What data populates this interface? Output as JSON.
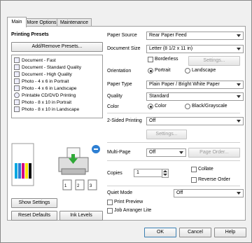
{
  "tabs": [
    "Main",
    "More Options",
    "Maintenance"
  ],
  "presets": {
    "title": "Printing Presets",
    "add_remove_label": "Add/Remove Presets...",
    "items": [
      "Document - Fast",
      "Document - Standard Quality",
      "Document - High Quality",
      "Photo - 4 x 6 in Portrait",
      "Photo - 4 x 6 in Landscape",
      "Printable CD/DVD Printing",
      "Photo - 8 x 10 in Portrait",
      "Photo - 8 x 10 in Landscape"
    ]
  },
  "settings": {
    "paper_source_label": "Paper Source",
    "paper_source_value": "Rear Paper Feed",
    "document_size_label": "Document Size",
    "document_size_value": "Letter (8 1/2 x 11 in)",
    "borderless_label": "Borderless",
    "borderless_settings_label": "Settings...",
    "orientation_label": "Orientation",
    "portrait_label": "Portrait",
    "landscape_label": "Landscape",
    "paper_type_label": "Paper Type",
    "paper_type_value": "Plain Paper / Bright White Paper",
    "quality_label": "Quality",
    "quality_value": "Standard",
    "color_label": "Color",
    "color_option_label": "Color",
    "bw_option_label": "Black/Grayscale",
    "two_sided_label": "2-Sided Printing",
    "two_sided_value": "Off",
    "two_sided_settings_label": "Settings...",
    "multipage_label": "Multi-Page",
    "multipage_value": "Off",
    "page_order_label": "Page Order...",
    "copies_label": "Copies",
    "copies_value": "1",
    "collate_label": "Collate",
    "reverse_order_label": "Reverse Order",
    "quiet_mode_label": "Quiet Mode",
    "quiet_mode_value": "Off",
    "print_preview_label": "Print Preview",
    "job_arranger_label": "Job Arranger Lite"
  },
  "left_buttons": {
    "show_settings": "Show Settings",
    "reset_defaults": "Reset Defaults",
    "ink_levels": "Ink Levels"
  },
  "footer": {
    "ok": "OK",
    "cancel": "Cancel",
    "help": "Help"
  },
  "colors": {
    "accent": "#3c7fb1",
    "ink_cyan": "#00a7e1",
    "ink_magenta": "#d6007e",
    "ink_yellow": "#ffe600",
    "ink_black": "#111111",
    "status_blue": "#2d7fd3",
    "status_green": "#2ea836"
  }
}
